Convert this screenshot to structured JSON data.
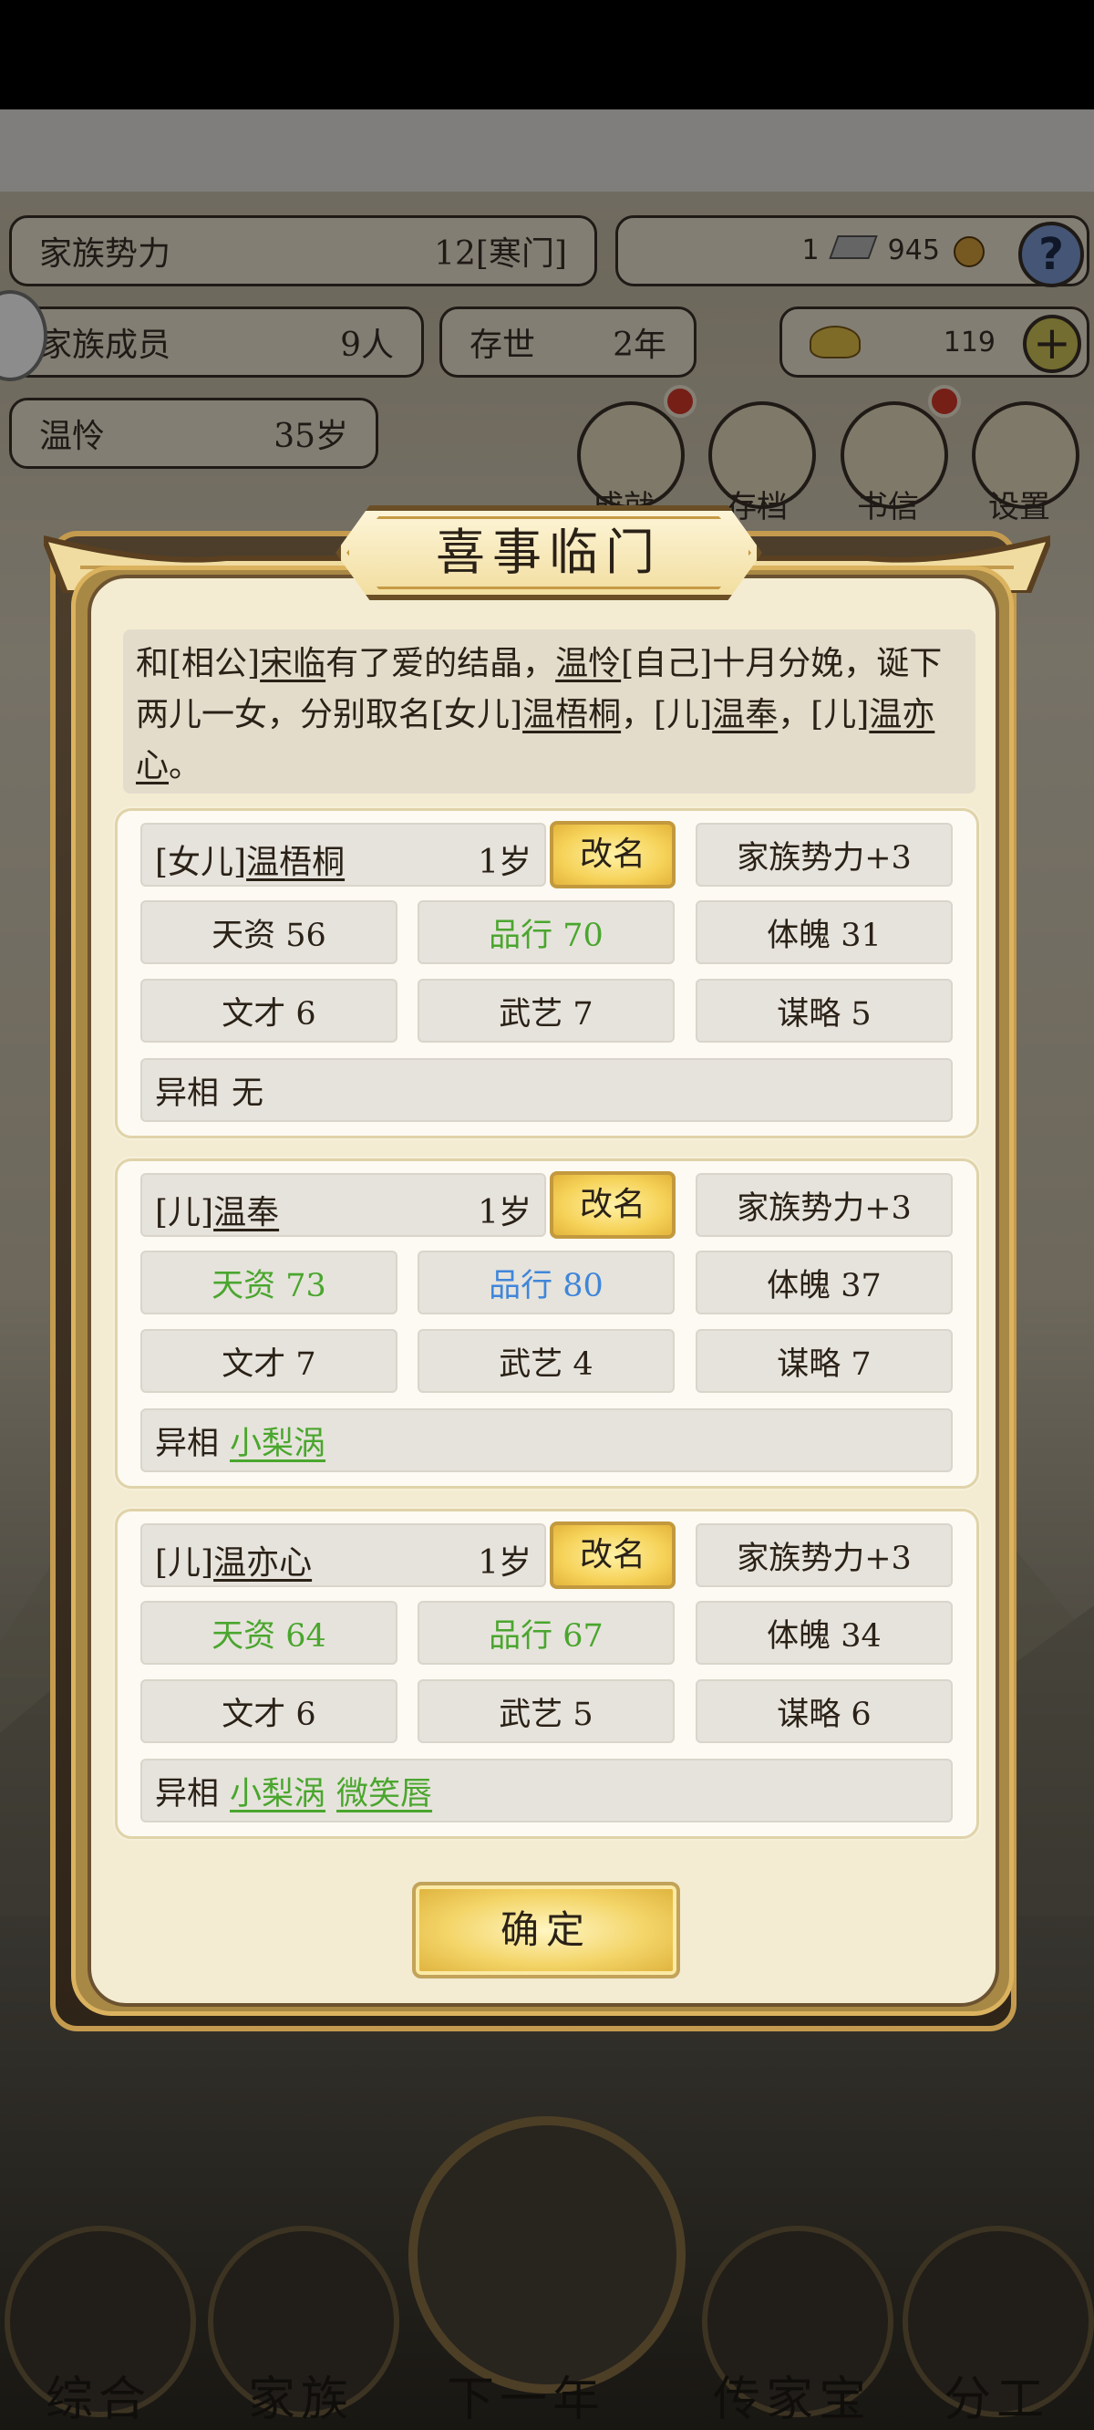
{
  "background": {
    "stats": {
      "family_power_label": "家族势力",
      "family_power_value": "12[寒门]",
      "silver_value": "1",
      "coin_value": "945",
      "members_label": "家族成员",
      "members_value": "9人",
      "existence_label": "存世",
      "existence_value": "2年",
      "gold_value": "119",
      "player_name": "温怜",
      "player_age": "35岁"
    },
    "help_symbol": "?",
    "plus_symbol": "+",
    "circle_buttons": [
      "成就",
      "存档",
      "书信",
      "设置"
    ],
    "bottom_nav": [
      "综合",
      "家族",
      "下一年",
      "传家宝",
      "分工"
    ]
  },
  "modal": {
    "title": "喜事临门",
    "announcement": {
      "p1": "和[相公]",
      "spouse": "宋临",
      "p2": "有了爱的结晶，",
      "self_name": "温怜",
      "p3": "[自己]十月分娩，诞下两儿一女，分别取名[女儿]",
      "child1": "温梧桐",
      "p4": "，[儿]",
      "child2": "温奉",
      "p5": "，[儿]",
      "child3": "温亦心",
      "p6": "。"
    },
    "rename_label": "改名",
    "confirm_label": "确定",
    "children": [
      {
        "relation": "[女儿]",
        "name": "温梧桐",
        "age": "1岁",
        "family_power": "家族势力+3",
        "talent": "天资 56",
        "conduct": "品行 70",
        "physique": "体魄 31",
        "literary": "文才 6",
        "martial": "武艺 7",
        "strategy": "谋略 5",
        "traits_label": "异相",
        "traits_none": "无",
        "traits": []
      },
      {
        "relation": "[儿]",
        "name": "温奉",
        "age": "1岁",
        "family_power": "家族势力+3",
        "talent": "天资 73",
        "conduct": "品行 80",
        "physique": "体魄 37",
        "literary": "文才 7",
        "martial": "武艺 4",
        "strategy": "谋略 7",
        "traits_label": "异相",
        "traits": [
          "小梨涡"
        ]
      },
      {
        "relation": "[儿]",
        "name": "温亦心",
        "age": "1岁",
        "family_power": "家族势力+3",
        "talent": "天资 64",
        "conduct": "品行 67",
        "physique": "体魄 34",
        "literary": "文才 6",
        "martial": "武艺 5",
        "strategy": "谋略 6",
        "traits_label": "异相",
        "traits": [
          "小梨涡",
          "微笑唇"
        ]
      }
    ],
    "colors": {
      "green": "#4aa62e",
      "blue": "#3f86d9",
      "gold_button": "#f6d35a",
      "panel": "#f3ecd2"
    }
  }
}
